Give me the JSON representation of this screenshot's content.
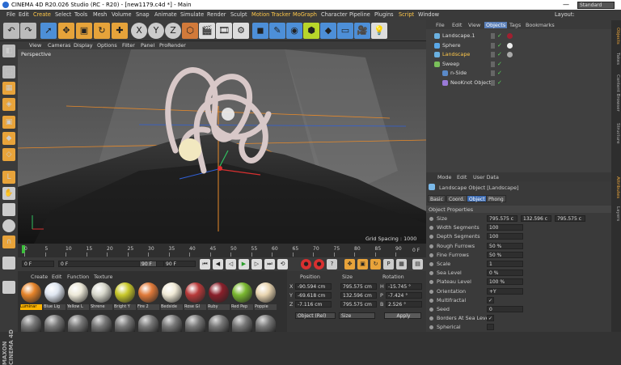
{
  "window": {
    "title": "CINEMA 4D R20.026 Studio (RC - R20) - [new1179.c4d *] - Main",
    "min_glyph": "—",
    "max_glyph": "☐",
    "close_glyph": "✕"
  },
  "menu": {
    "items": [
      "File",
      "Edit",
      "Create",
      "Select",
      "Tools",
      "Mesh",
      "Volume",
      "Snap",
      "Animate",
      "Simulate",
      "Render",
      "Sculpt",
      "Motion Tracker",
      "MoGraph",
      "Character",
      "Pipeline",
      "Plugins",
      "Script",
      "Window"
    ],
    "layout_label": "Layout:",
    "layout_value": "Standard"
  },
  "toolbar": {
    "axis_x": "X",
    "axis_y": "Y",
    "axis_z": "Z"
  },
  "viewport": {
    "menu": [
      "View",
      "Cameras",
      "Display",
      "Options",
      "Filter",
      "Panel",
      "ProRender"
    ],
    "label": "Perspective",
    "grid_spacing": "Grid Spacing : 1000 cm"
  },
  "timeline": {
    "ticks": [
      "0",
      "5",
      "10",
      "15",
      "20",
      "25",
      "30",
      "35",
      "40",
      "45",
      "50",
      "55",
      "60",
      "65",
      "70",
      "75",
      "80",
      "85",
      "90"
    ],
    "current_frame": "0 F"
  },
  "transport": {
    "start_field": "0 F",
    "min_field": "0 F",
    "max_field": "90 F",
    "end_field": "90 F"
  },
  "materials": {
    "menu": [
      "Create",
      "Edit",
      "Function",
      "Texture"
    ],
    "items": [
      {
        "label": "Luminar",
        "color": "#e6842a",
        "selected": true
      },
      {
        "label": "Blue Lig",
        "color": "#dfe6f0",
        "selected": false
      },
      {
        "label": "Yellow L",
        "color": "#ece8d8",
        "selected": false
      },
      {
        "label": "Shrene",
        "color": "#d8d8cc",
        "selected": false
      },
      {
        "label": "Bright Y",
        "color": "#c8c82a",
        "selected": false
      },
      {
        "label": "Fire 2",
        "color": "#e07a3a",
        "selected": false
      },
      {
        "label": "Bedside",
        "color": "#f0ead6",
        "selected": false
      },
      {
        "label": "Rose Gl",
        "color": "#b83a3a",
        "selected": false
      },
      {
        "label": "Ruby",
        "color": "#8a1f2a",
        "selected": false
      },
      {
        "label": "Red Pep",
        "color": "#7ab830",
        "selected": false
      },
      {
        "label": "Poppie",
        "color": "#e8d4b0",
        "selected": false
      }
    ]
  },
  "coords": {
    "headers": [
      "Position",
      "Size",
      "Rotation"
    ],
    "rows": [
      {
        "axis": "X",
        "pos": "-90.594 cm",
        "size": "795.575 cm",
        "rot_axis": "H",
        "rot": "-15.745 °"
      },
      {
        "axis": "Y",
        "pos": "-69.618 cm",
        "size": "132.596 cm",
        "rot_axis": "P",
        "rot": "-7.424 °"
      },
      {
        "axis": "Z",
        "pos": "-7.116 cm",
        "size": "795.575 cm",
        "rot_axis": "B",
        "rot": "2.526 °"
      }
    ],
    "mode_select": "Object (Rel)",
    "size_select": "Size",
    "apply_label": "Apply"
  },
  "objects": {
    "menu": [
      "File",
      "Edit",
      "View",
      "Objects",
      "Tags",
      "Bookmarks"
    ],
    "items": [
      {
        "name": "Landscape.1",
        "indent": 0,
        "active": false
      },
      {
        "name": "Sphere",
        "indent": 0,
        "active": false
      },
      {
        "name": "Landscape",
        "indent": 0,
        "active": true
      },
      {
        "name": "Sweep",
        "indent": 0,
        "active": false
      },
      {
        "name": "n-Side",
        "indent": 1,
        "active": false
      },
      {
        "name": "NeoKnot Object",
        "indent": 1,
        "active": false
      }
    ]
  },
  "attributes": {
    "menu": [
      "Mode",
      "Edit",
      "User Data"
    ],
    "object_title": "Landscape Object [Landscape]",
    "tabs": [
      "Basic",
      "Coord.",
      "Object",
      "Phong"
    ],
    "active_tab": "Object",
    "section": "Object Properties",
    "props": [
      {
        "label": "Size",
        "value": "795.575 c",
        "value2": "132.596 c",
        "value3": "795.575 c"
      },
      {
        "label": "Width Segments",
        "value": "100"
      },
      {
        "label": "Depth Segments",
        "value": "100"
      },
      {
        "label": "Rough Furrows",
        "value": "50 %"
      },
      {
        "label": "Fine Furrows",
        "value": "50 %"
      },
      {
        "label": "Scale",
        "value": "1"
      },
      {
        "label": "Sea Level",
        "value": "0 %"
      },
      {
        "label": "Plateau Level",
        "value": "100 %"
      },
      {
        "label": "Orientation",
        "value": "+Y"
      },
      {
        "label": "Multifractal",
        "value": "✓"
      },
      {
        "label": "Seed",
        "value": "0"
      },
      {
        "label": "Borders At Sea Level",
        "value": "✓"
      },
      {
        "label": "Spherical",
        "value": ""
      }
    ]
  },
  "right_tabs": [
    "Objects",
    "Takes",
    "Content Browser",
    "Structure",
    "Attributes",
    "Layers"
  ],
  "colors": {
    "accent_orange": "#ffb400",
    "selection_blue": "#3f6db3",
    "object_active": "#ffc84a"
  }
}
